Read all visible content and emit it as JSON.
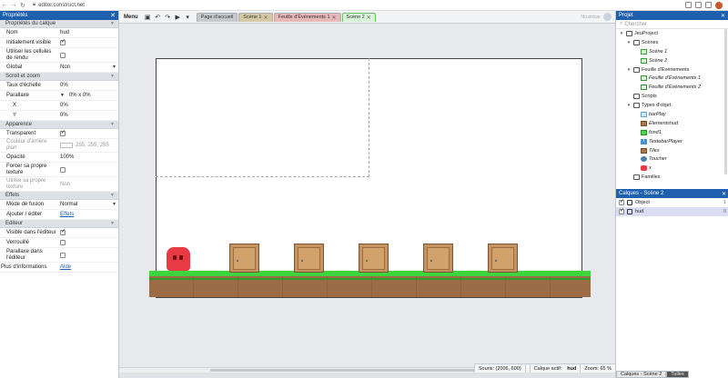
{
  "browser": {
    "url": "editor.construct.net"
  },
  "left_panel": {
    "title": "Propriétés",
    "sections": {
      "layer": "Propriétés du calque",
      "scroll": "Scroll et zoom",
      "appearance": "Apparence",
      "effects": "Effets",
      "editor": "Editeur"
    },
    "props": {
      "name_label": "Nom",
      "name_value": "hud",
      "initially_visible_label": "Initialement visible",
      "use_render_cells_label": "Utiliser les cellules de rendu",
      "global_label": "Global",
      "global_value": "Non",
      "scale_rate_label": "Taux d'échelle",
      "scale_rate_value": "0%",
      "parallax_label": "Parallaxe",
      "parallax_value": "0% x 0%",
      "x_label": "X",
      "x_value": "0%",
      "y_label": "Y",
      "y_value": "0%",
      "transparent_label": "Transparent",
      "bg_color_label": "Couleur d'arrière plan",
      "bg_color_value": "255, 255, 255",
      "opacity_label": "Opacité",
      "opacity_value": "100%",
      "force_own_texture_label": "Forcer sa propre texture",
      "use_own_texture_label": "Utilise sa propre texture",
      "use_own_texture_value": "Non",
      "blend_mode_label": "Mode de fusion",
      "blend_mode_value": "Normal",
      "add_edit_label": "Ajouter / éditer",
      "add_edit_link": "Effets",
      "visible_in_editor_label": "Visible dans l'éditeur",
      "locked_label": "Verrouillé",
      "parallax_in_editor_label": "Parallaxe dans l'éditeur",
      "more_info_label": "Plus d'informations",
      "more_info_link": "Aide"
    }
  },
  "toolbar": {
    "menu_label": "Menu",
    "tabs": [
      "Page d'accueil",
      "Scène 1",
      "Feuille d'Événements 1",
      "Scène 2"
    ],
    "close_glyph": "✕",
    "user_label": "Nosinkar"
  },
  "status": {
    "mouse": "Souris: (2006, 600)",
    "active_layer_label": "Calque actif:",
    "active_layer_value": "hud",
    "zoom": "Zoom: 65 %"
  },
  "project_panel": {
    "title": "Projet",
    "search_placeholder": "Chercher",
    "tree": [
      {
        "label": "JeuProject",
        "icon": "folder-icon",
        "level": 0,
        "arrow": "▾"
      },
      {
        "label": "Scènes",
        "icon": "folder-icon",
        "level": 1,
        "arrow": "▾"
      },
      {
        "label": "Scène 1",
        "icon": "scene-icon",
        "level": 2,
        "arrow": "",
        "italic": true
      },
      {
        "label": "Scène 2",
        "icon": "scene-icon",
        "level": 2,
        "arrow": "",
        "italic": true
      },
      {
        "label": "Feuille d'Événements",
        "icon": "folder-icon",
        "level": 1,
        "arrow": "▾"
      },
      {
        "label": "Feuille d'Événements 1",
        "icon": "sheet-icon",
        "level": 2,
        "arrow": "",
        "italic": true
      },
      {
        "label": "Feuille d'Événements 2",
        "icon": "sheet-icon",
        "level": 2,
        "arrow": "",
        "italic": true
      },
      {
        "label": "Scripts",
        "icon": "folder-icon",
        "level": 1,
        "arrow": ""
      },
      {
        "label": "Types d'objet",
        "icon": "folder-icon",
        "level": 1,
        "arrow": "▾"
      },
      {
        "label": "barPlay",
        "icon": "sprite-icon",
        "level": 2,
        "arrow": "",
        "italic": true
      },
      {
        "label": "Elementshud",
        "icon": "brown-sprite-icon",
        "level": 2,
        "arrow": "",
        "italic": true
      },
      {
        "label": "fond1",
        "icon": "green-sprite-icon",
        "level": 2,
        "arrow": "",
        "italic": true
      },
      {
        "label": "TextebarPlayer",
        "icon": "text-icon",
        "level": 2,
        "arrow": "",
        "italic": true
      },
      {
        "label": "Tiles",
        "icon": "brown-sprite-icon",
        "level": 2,
        "arrow": "",
        "italic": true
      },
      {
        "label": "Toucher",
        "icon": "touch-icon",
        "level": 2,
        "arrow": "",
        "italic": true
      },
      {
        "label": "x",
        "icon": "red-sprite-icon",
        "level": 2,
        "arrow": "",
        "italic": true
      },
      {
        "label": "Familles",
        "icon": "folder-icon",
        "level": 1,
        "arrow": ""
      }
    ]
  },
  "layers_panel": {
    "title": "Calques - Scène 2",
    "layers": [
      {
        "name": "Object",
        "index": "1"
      },
      {
        "name": "hud",
        "index": "0"
      }
    ]
  },
  "bottom_tabs": [
    "Calques - Scène 2",
    "Tuiles"
  ]
}
